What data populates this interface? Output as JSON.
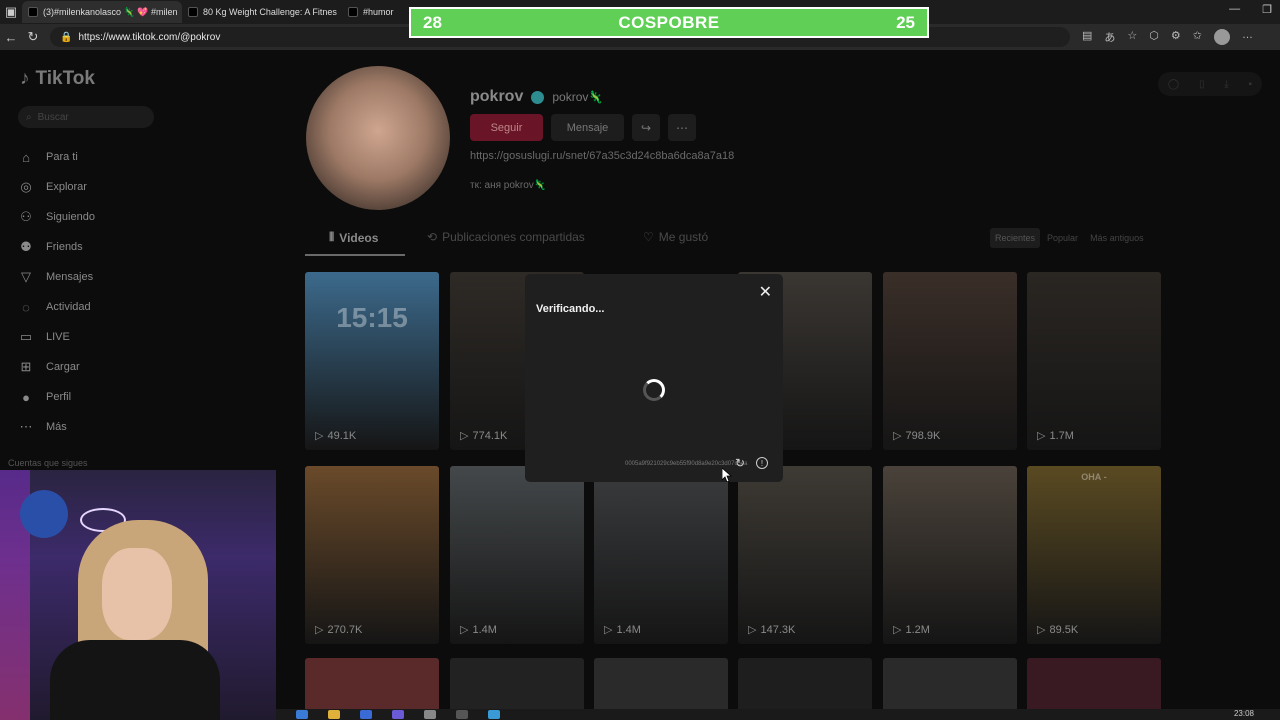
{
  "browser": {
    "tabs": [
      {
        "label": "(3)#milenkanolasco 🦎 💖 #milen",
        "active": true
      },
      {
        "label": "80 Kg Weight Challenge: A Fitnes",
        "active": false
      },
      {
        "label": "#humor",
        "active": false
      }
    ],
    "url": "https://www.tiktok.com/@pokrov"
  },
  "banner": {
    "left_score": "28",
    "title": "COSPOBRE",
    "right_score": "25",
    "color": "#5fcf55"
  },
  "sidebar": {
    "logo": "TikTok",
    "search_placeholder": "Buscar",
    "items": [
      {
        "label": "Para ti",
        "icon": "home-icon"
      },
      {
        "label": "Explorar",
        "icon": "compass-icon"
      },
      {
        "label": "Siguiendo",
        "icon": "user-follow-icon"
      },
      {
        "label": "Friends",
        "icon": "friends-icon"
      },
      {
        "label": "Mensajes",
        "icon": "message-icon"
      },
      {
        "label": "Actividad",
        "icon": "bell-icon"
      },
      {
        "label": "LIVE",
        "icon": "live-icon"
      },
      {
        "label": "Cargar",
        "icon": "upload-icon"
      },
      {
        "label": "Perfil",
        "icon": "profile-icon"
      },
      {
        "label": "Más",
        "icon": "more-icon"
      }
    ],
    "section_label": "Cuentas que sigues"
  },
  "profile": {
    "username": "pokrov",
    "nickname": "pokrov🦎",
    "follow_label": "Seguir",
    "message_label": "Mensaje",
    "link": "https://gosuslugi.ru/snet/67a35c3d24c8ba6dca8a7a18",
    "bio": "тк: аня pokrov🦎"
  },
  "profile_tabs": [
    {
      "label": "Videos",
      "active": true
    },
    {
      "label": "Publicaciones compartidas",
      "active": false
    },
    {
      "label": "Me gustó",
      "active": false
    }
  ],
  "sort_options": [
    {
      "label": "Recientes",
      "active": true
    },
    {
      "label": "Popular",
      "active": false
    },
    {
      "label": "Más antiguos",
      "active": false
    }
  ],
  "videos_row1": [
    {
      "views": "49.1K",
      "overlay": "15:15",
      "color": "#3c6a8c"
    },
    {
      "views": "774.1K",
      "overlay": "",
      "color": "#2e2a26"
    },
    {
      "views": "",
      "overlay": "",
      "color": "#1a1a1a"
    },
    {
      "views": "",
      "overlay": "",
      "color": "#3a3632"
    },
    {
      "views": "798.9K",
      "overlay": "",
      "color": "#3a2e28"
    },
    {
      "views": "1.7M",
      "overlay": "",
      "color": "#2a2622"
    }
  ],
  "videos_row2": [
    {
      "views": "270.7K",
      "overlay": "",
      "color": "#6a4a2a"
    },
    {
      "views": "1.4M",
      "overlay": "",
      "color": "#44484a"
    },
    {
      "views": "1.4M",
      "overlay": "",
      "color": "#3a3c3e"
    },
    {
      "views": "147.3K",
      "overlay": "",
      "color": "#3e3a34"
    },
    {
      "views": "1.2M",
      "overlay": "",
      "color": "#4a423a"
    },
    {
      "views": "89.5K",
      "overlay": "ОНА -",
      "color": "#5a4a22"
    }
  ],
  "modal": {
    "title": "Verificando...",
    "code": "0005a9f921029c9eb55f90d8a9e20c3d07c5ea"
  },
  "taskbar": {
    "time": "23:08"
  }
}
